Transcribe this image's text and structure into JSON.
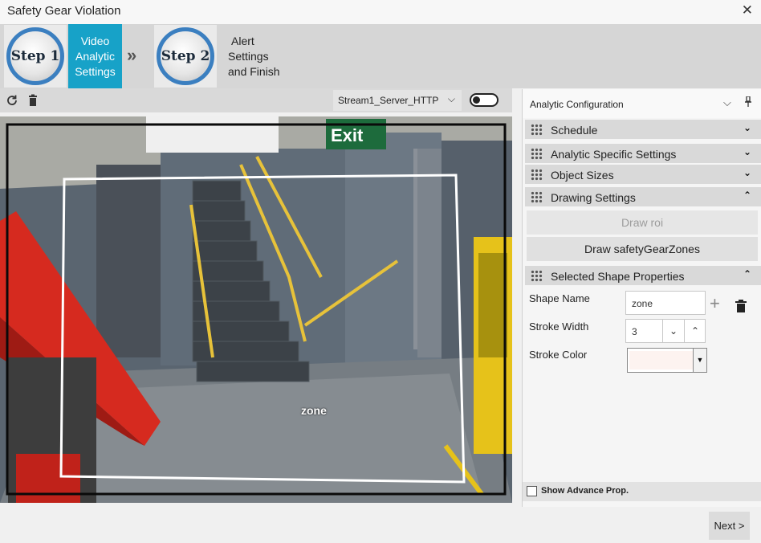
{
  "window": {
    "title": "Safety Gear Violation",
    "close_glyph": "✕"
  },
  "wizard": {
    "step1": {
      "badge": "Step 1",
      "label_lines": [
        "Video",
        "Analytic",
        "Settings"
      ]
    },
    "separator_glyph": "»",
    "step2": {
      "badge": "Step 2",
      "label_lines": [
        "Alert",
        "Settings",
        "and Finish"
      ]
    }
  },
  "toolbar": {
    "refresh_icon": "refresh-icon",
    "delete_icon": "trash-icon",
    "stream": {
      "selected": "Stream1_Server_HTTP"
    },
    "toggle": {
      "state": "off"
    }
  },
  "video": {
    "zone_label": "zone"
  },
  "panel": {
    "title": "Analytic Configuration",
    "sections": {
      "schedule": "Schedule",
      "analytic_specific": "Analytic Specific Settings",
      "object_sizes": "Object Sizes",
      "drawing_settings": "Drawing Settings",
      "selected_shape": "Selected Shape Properties"
    },
    "buttons": {
      "draw_roi": "Draw roi",
      "draw_zones": "Draw safetyGearZones"
    },
    "properties": {
      "shape_name_label": "Shape Name",
      "shape_name_value": "zone",
      "stroke_width_label": "Stroke Width",
      "stroke_width_value": "3",
      "stroke_color_label": "Stroke Color",
      "stroke_color_value": "#fdf3f0"
    },
    "advance": {
      "label": "Show Advance Prop.",
      "checked": false
    }
  },
  "footer": {
    "next_label": "Next >"
  },
  "colors": {
    "step_active": "#17a2c8",
    "badge_ring": "#3b7fc0"
  }
}
